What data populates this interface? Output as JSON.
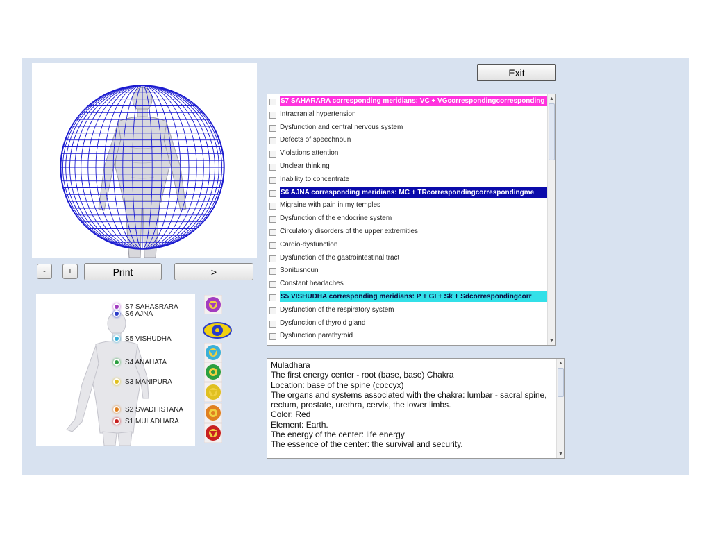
{
  "toolbar": {
    "minus_label": "-",
    "plus_label": "+",
    "print_label": "Print",
    "next_label": ">",
    "exit_label": "Exit"
  },
  "symptoms": {
    "rows": [
      {
        "type": "header",
        "text": "S7 SAHARARA corresponding meridians: VC + VGcorrespondingcorresponding",
        "color": "#ff33dd"
      },
      {
        "type": "item",
        "text": "Intracranial hypertension"
      },
      {
        "type": "item",
        "text": "Dysfunction and central nervous system"
      },
      {
        "type": "item",
        "text": "Defects of speechnoun"
      },
      {
        "type": "item",
        "text": "Violations attention"
      },
      {
        "type": "item",
        "text": "Unclear thinking"
      },
      {
        "type": "item",
        "text": "Inability to concentrate"
      },
      {
        "type": "header",
        "text": "S6 AJNA corresponding meridians: MC + TRcorrespondingcorrespondingme",
        "color": "#0a0aaa"
      },
      {
        "type": "item",
        "text": "Migraine with pain in my temples"
      },
      {
        "type": "item",
        "text": "Dysfunction of the endocrine system"
      },
      {
        "type": "item",
        "text": "Circulatory disorders of the upper extremities"
      },
      {
        "type": "item",
        "text": "Cardio-dysfunction"
      },
      {
        "type": "item",
        "text": "Dysfunction of the gastrointestinal tract"
      },
      {
        "type": "item",
        "text": "Sonitusnoun"
      },
      {
        "type": "item",
        "text": "Constant headaches"
      },
      {
        "type": "header",
        "text": "S5 VISHUDHA corresponding meridians: P + GI + Sk + Sdcorrespondingcorr",
        "color": "#33e0e8"
      },
      {
        "type": "item",
        "text": "Dysfunction of the respiratory system"
      },
      {
        "type": "item",
        "text": "Dysfunction of thyroid gland"
      },
      {
        "type": "item",
        "text": "Dysfunction parathyroid"
      }
    ]
  },
  "description": {
    "lines": [
      "Muladhara",
      "The first energy center - root (base, base) Chakra",
      "Location: base of the spine (coccyx)",
      "The organs and systems associated with the chakra: lumbar - sacral spine, rectum, prostate, urethra, cervix, the lower limbs.",
      "Color: Red",
      "Element: Earth.",
      "The energy of the center: life energy",
      "The essence of the center: the survival and security."
    ]
  },
  "chakras": [
    {
      "label": "S7 SAHASRARA",
      "color": "#a33cc0",
      "icon": "sahasrara-icon"
    },
    {
      "label": "S6 AJNA",
      "color": "#2a3cc8",
      "icon": "ajna-icon"
    },
    {
      "label": "S5 VISHUDHA",
      "color": "#3ab0d8",
      "icon": "vishudha-icon"
    },
    {
      "label": "S4 ANAHATA",
      "color": "#2ca040",
      "icon": "anahata-icon"
    },
    {
      "label": "S3 MANIPURA",
      "color": "#e0c020",
      "icon": "manipura-icon"
    },
    {
      "label": "S2 SVADHISTANA",
      "color": "#e08020",
      "icon": "svadhistana-icon"
    },
    {
      "label": "S1 MULADHARA",
      "color": "#c82020",
      "icon": "muladhara-icon"
    }
  ],
  "colors": {
    "app_background": "#d8e2f0",
    "sphere_grid": "#1a1ad0"
  }
}
